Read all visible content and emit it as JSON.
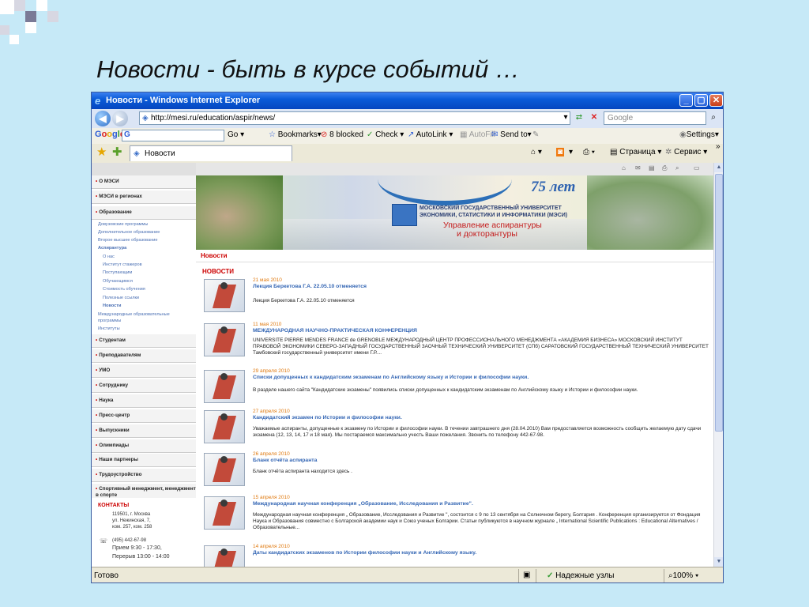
{
  "slide": {
    "title": "Новости - быть в курсе событий …"
  },
  "window": {
    "title": "Новости - Windows Internet Explorer"
  },
  "address": {
    "url": "http://mesi.ru/education/aspir/news/",
    "search_placeholder": "Google"
  },
  "googlebar": {
    "logo": "Google",
    "g": "G",
    "go": "Go",
    "bookmarks": "Bookmarks",
    "blocked": "8 blocked",
    "check": "Check",
    "autolink": "AutoLink",
    "autofill": "AutoFill",
    "sendto": "Send to",
    "settings": "Settings"
  },
  "tabs": {
    "active": "Новости"
  },
  "commandbar": {
    "page": "Страница",
    "service": "Сервис"
  },
  "sidebar": {
    "items": [
      "О МЭСИ",
      "МЭСИ в регионах",
      "Образование",
      "Студентам",
      "Преподавателям",
      "УМО",
      "Сотруднику",
      "Наука",
      "Пресс-центр",
      "Выпускники",
      "Олимпиады",
      "Наши партнеры",
      "Трудоустройство",
      "Спортивный менеджмент, менеджмент в спорте"
    ],
    "education_sub": [
      "Довузовские программы",
      "Дополнительное образование",
      "Второе высшее образование",
      "Аспирантура"
    ],
    "aspir_sub": [
      "О нас",
      "Институт стажеров",
      "Поступающим",
      "Обучающимся",
      "Стоимость обучения",
      "Полезные ссылки",
      "Новости"
    ],
    "after_sub": [
      "Международные образовательные",
      "программы",
      "Институты"
    ]
  },
  "contacts": {
    "title": "КОНТАКТЫ",
    "address": [
      "119501, г. Москва",
      "ул. Нежинская, 7,",
      "ком. 257, ком. 258"
    ],
    "phone": "(495) 442-67-98",
    "hours": [
      "Прием 9:30 - 17:30,",
      "Перерыв 13:00 - 14:00"
    ]
  },
  "banner": {
    "anniversary": "75 лет",
    "university": [
      "МОСКОВСКИЙ ГОСУДАРСТВЕННЫЙ УНИВЕРСИТЕТ",
      "ЭКОНОМИКИ, СТАТИСТИКИ И ИНФОРМАТИКИ (МЭСИ)"
    ],
    "department": [
      "Управление аспирантуры",
      "и докторантуры"
    ]
  },
  "section_title": "Новости",
  "news_heading": "НОВОСТИ",
  "news": [
    {
      "date": "21 мая 2010",
      "title": "Лекция Беркетова Г.А. 22.05.10 отменяется",
      "body": "Лекция Беркетова Г.А. 22.05.10 отменяется"
    },
    {
      "date": "11 мая 2010",
      "title": "МЕЖДУНАРОДНАЯ НАУЧНО-ПРАКТИЧЕСКАЯ КОНФЕРЕНЦИЯ",
      "body": "UNIVERSITE PIERRE MENDES FRANCE de GRENOBLE МЕЖДУНАРОДНЫЙ ЦЕНТР ПРОФЕССИОНАЛЬНОГО МЕНЕДЖМЕНТА «АКАДЕМИЯ БИЗНЕСА» МОСКОВСКИЙ ИНСТИТУТ ПРАВОВОЙ ЭКОНОМИКИ СЕВЕРО-ЗАПАДНЫЙ ГОСУДАРСТВЕННЫЙ ЗАОЧНЫЙ ТЕХНИЧЕСКИЙ УНИВЕРСИТЕТ (СПб) САРАТОВСКИЙ ГОСУДАРСТВЕННЫЙ ТЕХНИЧЕСКИЙ УНИВЕРСИТЕТ Тамбовский государственный университет имени Г.Р...."
    },
    {
      "date": "29 апреля 2010",
      "title": "Списки допущенных к кандидатским экзаменам по Английскому языку и Истории и философии науки.",
      "body": "В разделе нашего сайта \"Кандидатские экзамены\" появились списки допущенных к кандидатским экзаменам по Английскому языку и Истории и философии науки."
    },
    {
      "date": "27 апреля 2010",
      "title": "Кандидатский экзамен по Истории и философии науки.",
      "body": "Уважаемые аспиранты, допущенные к экзамену по Истории и философии науки. В течении завтрашнего дня (28.04.2010) Вам предоставляется возможность сообщить желаемую дату сдачи экзамена (12, 13, 14, 17 и 18 мая). Мы постараемся максимально учесть Ваши пожелания. Звонить по телефону 442-67-98."
    },
    {
      "date": "26 апреля 2010",
      "title": "Бланк отчёта аспиранта",
      "body": "Бланк отчёта аспиранта находится здесь ."
    },
    {
      "date": "15 апреля 2010",
      "title": "Международная научная конференция „Образование, Исследования и Развитие\".",
      "body": "Международная научная конференция „ Образование, Исследования и Развитие \", состоится с 9 по 13 сентября на Солнечном берегу, Болгария . Конференция организируется от Фондация Наука и Образования совместно с Болгарской академии наук и Союз ученых Болгарии. Статьи публикуются в научном журнале „ International Scientific Publications : Educational Alternatives /Образовательные..."
    },
    {
      "date": "14 апреля 2010",
      "title": "Даты кандидатских экзаменов по Истории философии науки и Английскому языку.",
      "body": ""
    }
  ],
  "status": {
    "ready": "Готово",
    "zone": "Надежные узлы",
    "zoom": "100%"
  }
}
